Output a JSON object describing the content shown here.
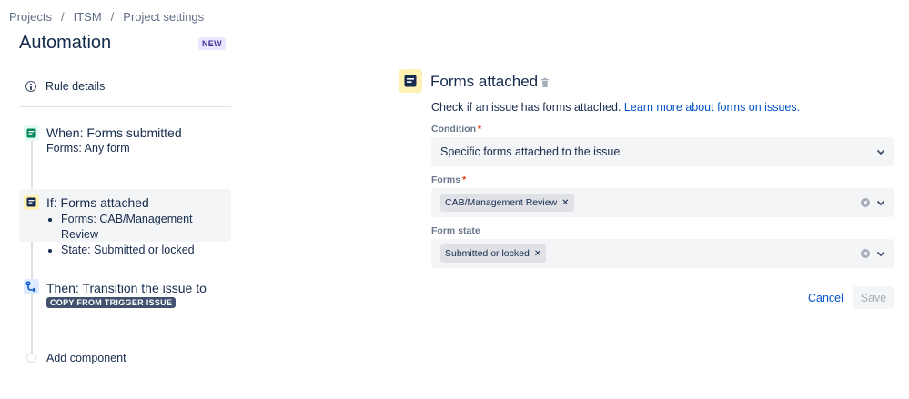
{
  "breadcrumb": {
    "items": [
      "Projects",
      "ITSM",
      "Project settings"
    ],
    "separator": "/"
  },
  "header": {
    "title": "Automation",
    "badge": "NEW"
  },
  "sidebar": {
    "rule_details": "Rule details",
    "steps": [
      {
        "title": "When: Forms submitted",
        "sub": "Forms: Any form",
        "icon": "form-icon",
        "icon_color": "#00875a"
      },
      {
        "title": "If: Forms attached",
        "bullets": [
          "Forms: CAB/Management Review",
          "State: Submitted or locked"
        ],
        "icon": "form-icon",
        "icon_color": "#172b4d"
      },
      {
        "title": "Then: Transition the issue to",
        "lozenge": "COPY FROM TRIGGER ISSUE",
        "icon": "transition-icon",
        "icon_color": "#0052cc"
      }
    ],
    "add_component": "Add component"
  },
  "panel": {
    "title": "Forms attached",
    "description": "Check if an issue has forms attached.",
    "link": "Learn more about forms on issues.",
    "fields": {
      "condition": {
        "label": "Condition",
        "required": "*",
        "value": "Specific forms attached to the issue"
      },
      "forms": {
        "label": "Forms",
        "required": "*",
        "tags": [
          "CAB/Management Review"
        ]
      },
      "form_state": {
        "label": "Form state",
        "tags": [
          "Submitted or locked"
        ]
      }
    },
    "actions": {
      "cancel": "Cancel",
      "save": "Save"
    }
  },
  "colors": {
    "link": "#0052cc",
    "text": "#172b4d",
    "subtle": "#6b778c",
    "required": "#de350b",
    "badge_bg": "#eae6ff",
    "badge_text": "#403294"
  }
}
